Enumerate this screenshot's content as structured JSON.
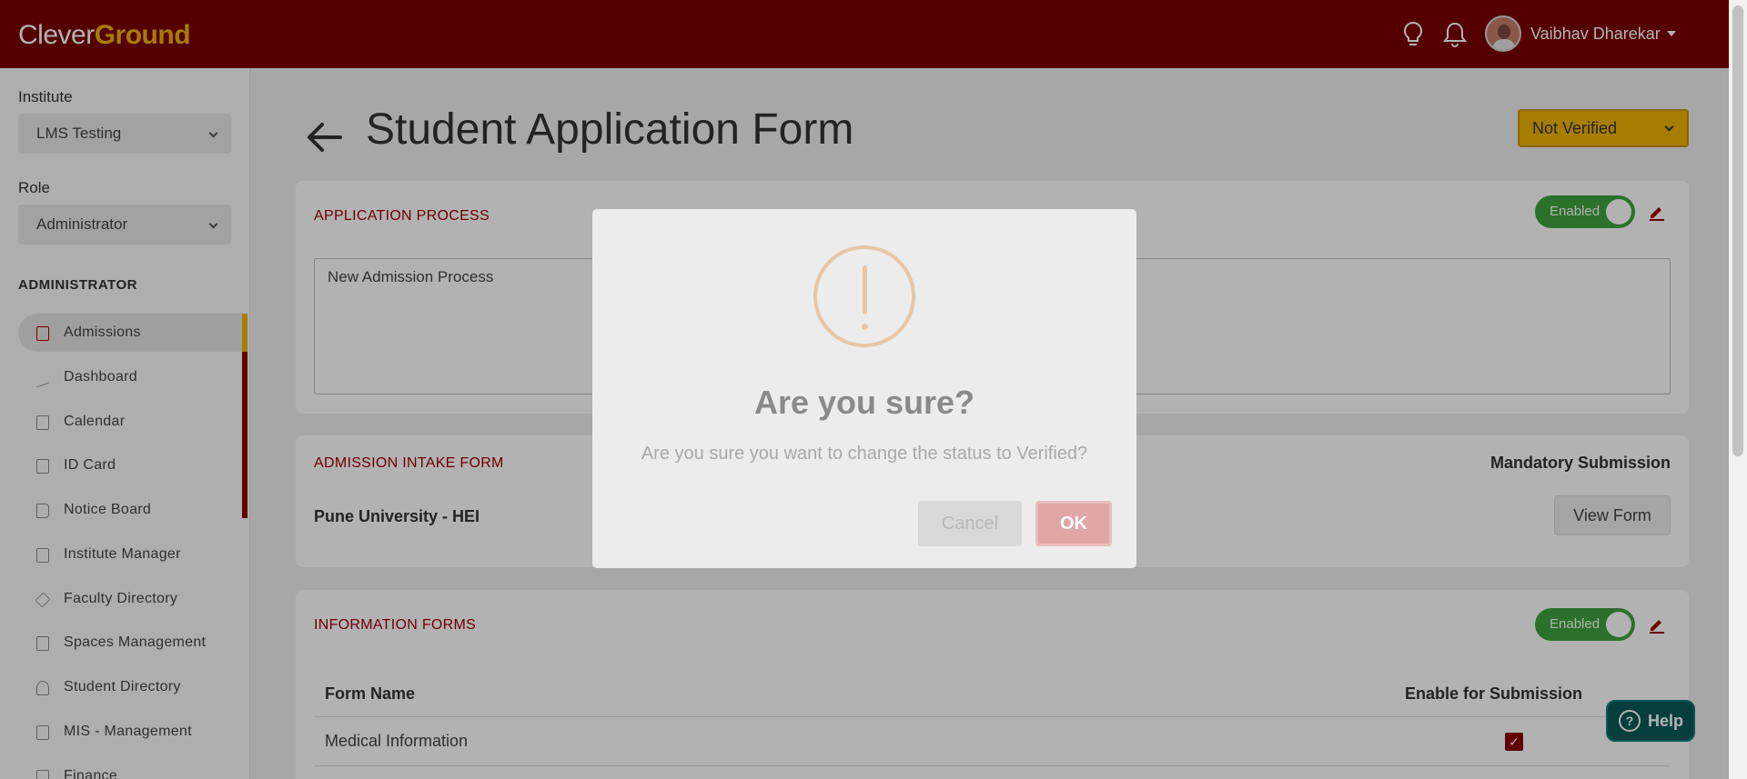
{
  "header": {
    "logo_part1": "Clever",
    "logo_part2": "Ground",
    "user_name": "Vaibhav Dharekar"
  },
  "sidebar": {
    "institute_label": "Institute",
    "institute_value": "LMS Testing",
    "role_label": "Role",
    "role_value": "Administrator",
    "section_title": "ADMINISTRATOR",
    "items": [
      {
        "label": "Admissions",
        "active": true
      },
      {
        "label": "Dashboard"
      },
      {
        "label": "Calendar"
      },
      {
        "label": "ID Card"
      },
      {
        "label": "Notice Board"
      },
      {
        "label": "Institute Manager"
      },
      {
        "label": "Faculty Directory"
      },
      {
        "label": "Spaces Management"
      },
      {
        "label": "Student Directory"
      },
      {
        "label": "MIS - Management"
      },
      {
        "label": "Finance"
      }
    ]
  },
  "main": {
    "title": "Student Application Form",
    "status_value": "Not Verified",
    "application_process": {
      "title": "APPLICATION PROCESS",
      "toggle_label": "Enabled",
      "textarea_value": "New Admission Process"
    },
    "admission_intake": {
      "title": "ADMISSION INTAKE FORM",
      "mandatory_label": "Mandatory Submission",
      "form_name": "Pune University - HEI",
      "view_form_label": "View Form"
    },
    "information_forms": {
      "title": "INFORMATION FORMS",
      "toggle_label": "Enabled",
      "columns": [
        "Form Name",
        "Enable for Submission"
      ],
      "rows": [
        {
          "name": "Medical Information",
          "enabled": true
        }
      ]
    }
  },
  "help_label": "Help",
  "dialog": {
    "title": "Are you sure?",
    "text": "Are you sure you want to change the status to Verified?",
    "cancel_label": "Cancel",
    "ok_label": "OK"
  },
  "colors": {
    "brand": "#7a0000",
    "accent": "#f0b400",
    "enabled": "#3ea33e"
  }
}
